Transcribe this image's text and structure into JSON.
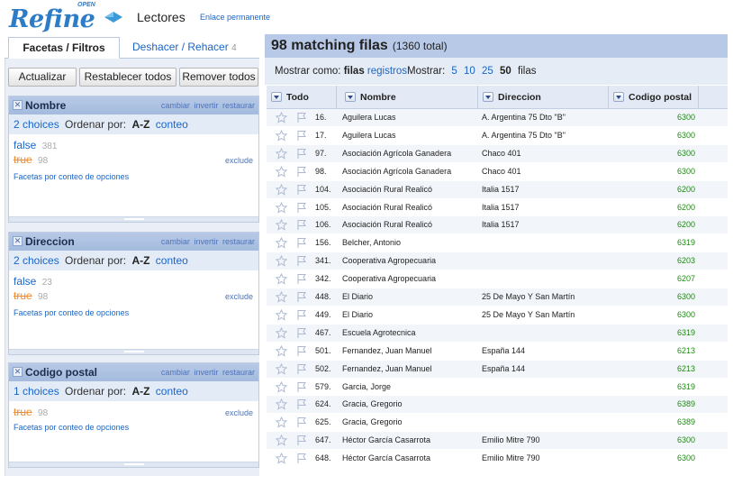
{
  "header": {
    "logo_text": "Refine",
    "logo_small": "OPEN",
    "project_name": "Lectores",
    "permalink": "Enlace permanente"
  },
  "left": {
    "tabs": [
      {
        "label": "Facetas / Filtros"
      },
      {
        "label": "Deshacer / Rehacer",
        "count": "4"
      }
    ],
    "buttons": {
      "refresh": "Actualizar",
      "reset_all": "Restablecer todos",
      "remove_all": "Remover todos"
    },
    "facet_actions": {
      "change": "cambiar",
      "invert": "invertir",
      "reset": "restaurar"
    },
    "facets": [
      {
        "name": "Nombre",
        "choices_count": "2 choices",
        "sort_label": "Ordenar por:",
        "sort_az": "A-Z",
        "sort_count": "conteo",
        "items": [
          {
            "label": "false",
            "count": "381"
          },
          {
            "label": "true",
            "count": "98",
            "action": "exclude"
          }
        ],
        "footer": "Facetas por conteo de opciones"
      },
      {
        "name": "Direccion",
        "choices_count": "2 choices",
        "sort_label": "Ordenar por:",
        "sort_az": "A-Z",
        "sort_count": "conteo",
        "items": [
          {
            "label": "false",
            "count": "23"
          },
          {
            "label": "true",
            "count": "98",
            "action": "exclude"
          }
        ],
        "footer": "Facetas por conteo de opciones"
      },
      {
        "name": "Codigo postal",
        "choices_count": "1 choices",
        "sort_label": "Ordenar por:",
        "sort_az": "A-Z",
        "sort_count": "conteo",
        "items": [
          {
            "label": "true",
            "count": "98",
            "action": "exclude"
          }
        ],
        "footer": "Facetas por conteo de opciones"
      }
    ]
  },
  "main": {
    "summary_count": "98 matching filas",
    "summary_total": "(1360 total)",
    "show_as_label": "Mostrar como:",
    "show_rows": "filas",
    "show_records": "registros",
    "show_label": "Mostrar:",
    "page_sizes": [
      "5",
      "10",
      "25",
      "50"
    ],
    "page_size_selected": "50",
    "page_unit": "filas",
    "columns": [
      "Todo",
      "Nombre",
      "Direccion",
      "Codigo postal"
    ],
    "rows": [
      {
        "n": "16.",
        "nombre": "Aguilera Lucas",
        "dir": "A. Argentina 75 Dto \"B\"",
        "cp": "6300"
      },
      {
        "n": "17.",
        "nombre": "Aguilera Lucas",
        "dir": "A. Argentina 75 Dto \"B\"",
        "cp": "6300"
      },
      {
        "n": "97.",
        "nombre": "Asociación Agrícola Ganadera",
        "dir": "Chaco 401",
        "cp": "6300"
      },
      {
        "n": "98.",
        "nombre": "Asociación Agrícola Ganadera",
        "dir": "Chaco 401",
        "cp": "6300"
      },
      {
        "n": "104.",
        "nombre": "Asociación Rural Realicó",
        "dir": "Italia 1517",
        "cp": "6200"
      },
      {
        "n": "105.",
        "nombre": "Asociación Rural Realicó",
        "dir": "Italia 1517",
        "cp": "6200"
      },
      {
        "n": "106.",
        "nombre": "Asociación Rural Realicó",
        "dir": "Italia 1517",
        "cp": "6200"
      },
      {
        "n": "156.",
        "nombre": "Belcher, Antonio",
        "dir": "",
        "cp": "6319"
      },
      {
        "n": "341.",
        "nombre": "Cooperativa Agropecuaria",
        "dir": "",
        "cp": "6203"
      },
      {
        "n": "342.",
        "nombre": "Cooperativa Agropecuaria",
        "dir": "",
        "cp": "6207"
      },
      {
        "n": "448.",
        "nombre": "El Diario",
        "dir": "25 De Mayo Y San Martín",
        "cp": "6300"
      },
      {
        "n": "449.",
        "nombre": "El Diario",
        "dir": "25 De Mayo Y San Martín",
        "cp": "6300"
      },
      {
        "n": "467.",
        "nombre": "Escuela Agrotecnica",
        "dir": "",
        "cp": "6319"
      },
      {
        "n": "501.",
        "nombre": "Fernandez, Juan Manuel",
        "dir": "España 144",
        "cp": "6213"
      },
      {
        "n": "502.",
        "nombre": "Fernandez, Juan Manuel",
        "dir": "España 144",
        "cp": "6213"
      },
      {
        "n": "579.",
        "nombre": "Garcia, Jorge",
        "dir": "",
        "cp": "6319"
      },
      {
        "n": "624.",
        "nombre": "Gracia, Gregorio",
        "dir": "",
        "cp": "6389"
      },
      {
        "n": "625.",
        "nombre": "Gracia, Gregorio",
        "dir": "",
        "cp": "6389"
      },
      {
        "n": "647.",
        "nombre": "Héctor García Casarrota",
        "dir": "Emilio Mitre 790",
        "cp": "6300"
      },
      {
        "n": "648.",
        "nombre": "Héctor García Casarrota",
        "dir": "Emilio Mitre 790",
        "cp": "6300"
      }
    ]
  },
  "colors": {
    "link": "#1a65c4",
    "accent": "#b7c9e6",
    "excluded": "#f08c33",
    "zip": "#1f8a12"
  }
}
